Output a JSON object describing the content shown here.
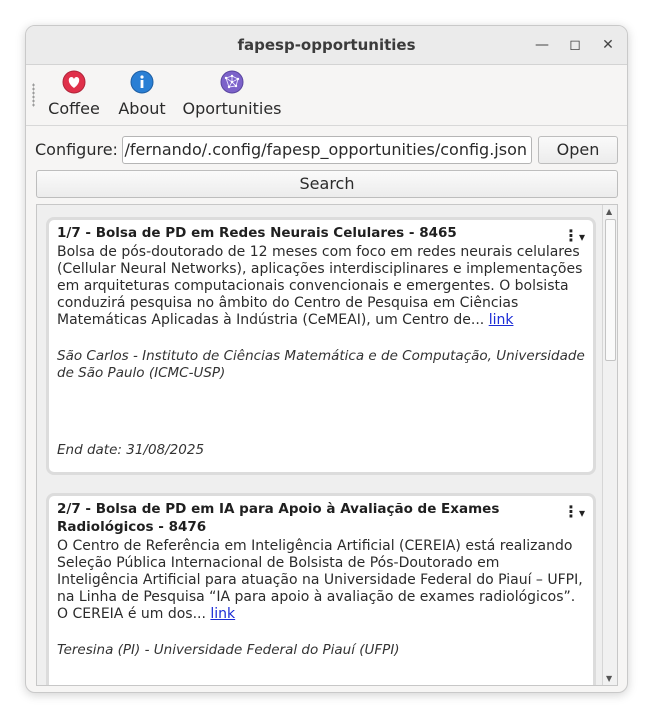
{
  "window": {
    "title": "fapesp-opportunities"
  },
  "toolbar": {
    "coffee_label": "Coffee",
    "about_label": "About",
    "opportunities_label": "Oportunities"
  },
  "config": {
    "label": "Configure:",
    "path_value": ":/fernando/.config/fapesp_opportunities/config.json",
    "open_label": "Open",
    "search_label": "Search"
  },
  "cards": [
    {
      "title": "1/7 - Bolsa de PD em Redes Neurais Celulares - 8465",
      "text": "Bolsa de pós-doutorado de 12 meses com foco em redes neurais celulares (Cellular Neural Networks), aplicações interdisciplinares e implementações em arquiteturas computacionais convencionais e emergentes. O bolsista conduzirá pesquisa no âmbito do Centro de Pesquisa em Ciências Matemáticas Aplicadas à Indústria (CeMEAI), um Centro de...",
      "link_label": "link",
      "place": "São Carlos - Instituto de Ciências Matemática e de Computação, Universidade de São Paulo (ICMC-USP)",
      "end_date": "End date: 31/08/2025"
    },
    {
      "title": "2/7 - Bolsa de PD em IA para Apoio à Avaliação de Exames Radiológicos - 8476",
      "text": "O Centro de Referência em Inteligência Artificial (CEREIA) está realizando Seleção Pública Internacional de Bolsista de Pós-Doutorado em Inteligência Artificial para atuação na Universidade Federal do Piauí – UFPI, na Linha de Pesquisa “IA para apoio à avaliação de exames radiológicos”. O CEREIA é um dos...",
      "link_label": "link",
      "place": "Teresina (PI) - Universidade Federal do Piauí (UFPI)"
    }
  ],
  "colors": {
    "link": "#1a2bd6",
    "coffee_icon": "#e0304a",
    "about_icon": "#2a7fd4",
    "opportunities_icon": "#7c62c9"
  }
}
